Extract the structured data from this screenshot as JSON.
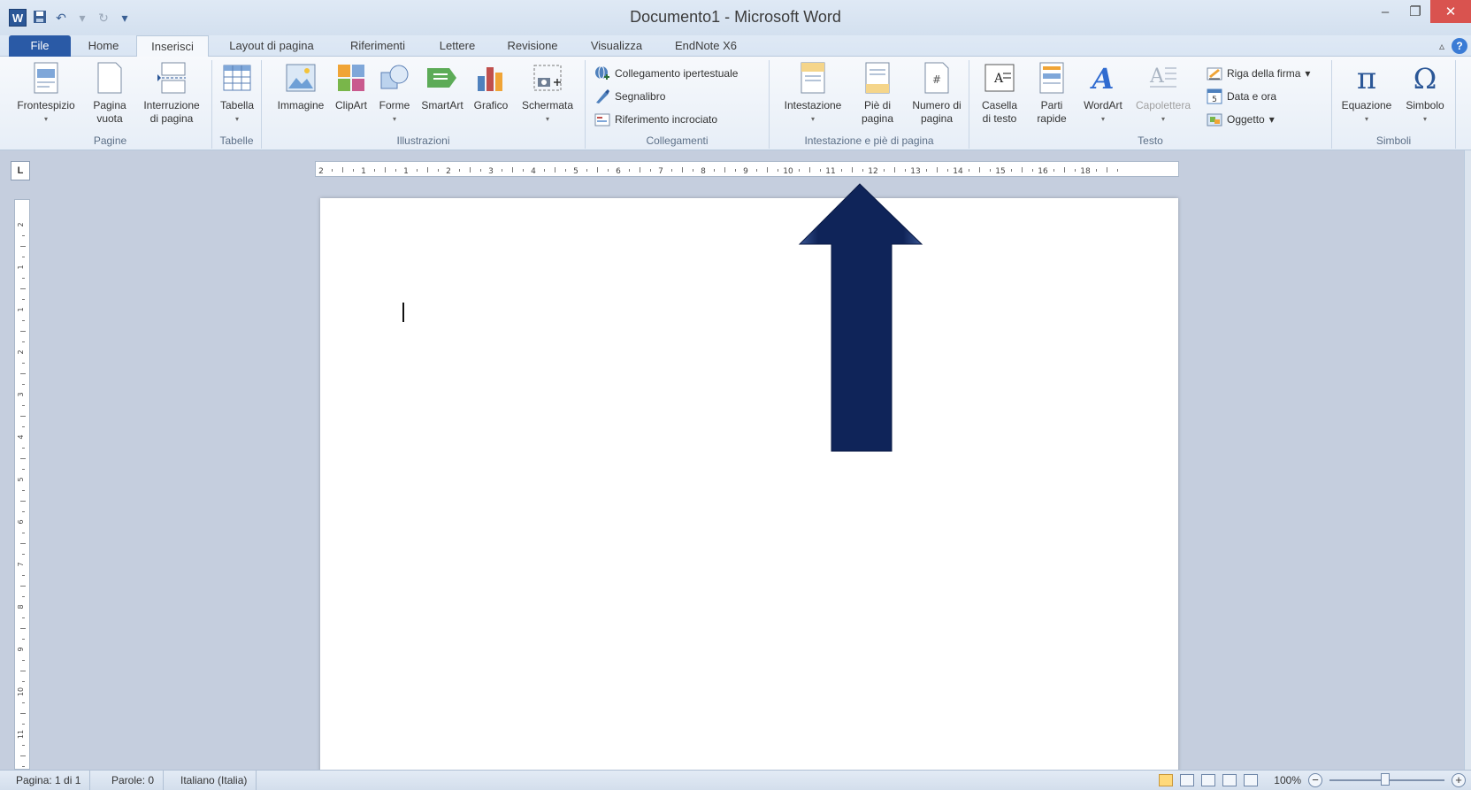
{
  "app": {
    "title": "Documento1 - Microsoft Word",
    "logo": "W"
  },
  "quick_access": {
    "icons": [
      "save-icon",
      "undo-icon",
      "redo-icon",
      "customize-icon"
    ]
  },
  "tabs": [
    {
      "label": "File"
    },
    {
      "label": "Home"
    },
    {
      "label": "Inserisci"
    },
    {
      "label": "Layout di pagina"
    },
    {
      "label": "Riferimenti"
    },
    {
      "label": "Lettere"
    },
    {
      "label": "Revisione"
    },
    {
      "label": "Visualizza"
    },
    {
      "label": "EndNote X6"
    }
  ],
  "active_tab": "Inserisci",
  "ribbon": {
    "pagine": {
      "label": "Pagine",
      "frontespizio": "Frontespizio",
      "pagina_vuota_1": "Pagina",
      "pagina_vuota_2": "vuota",
      "interruzione_1": "Interruzione",
      "interruzione_2": "di pagina"
    },
    "tabelle": {
      "label": "Tabelle",
      "tabella": "Tabella"
    },
    "illustrazioni": {
      "label": "Illustrazioni",
      "immagine": "Immagine",
      "clipart": "ClipArt",
      "forme": "Forme",
      "smartart": "SmartArt",
      "grafico": "Grafico",
      "schermata": "Schermata"
    },
    "collegamenti": {
      "label": "Collegamenti",
      "ipertestuale": "Collegamento ipertestuale",
      "segnalibro": "Segnalibro",
      "riferimento": "Riferimento incrociato"
    },
    "intestazione": {
      "label": "Intestazione e piè di pagina",
      "intestazione": "Intestazione",
      "pie_1": "Piè di",
      "pie_2": "pagina",
      "numero_1": "Numero di",
      "numero_2": "pagina"
    },
    "testo": {
      "label": "Testo",
      "casella_1": "Casella",
      "casella_2": "di testo",
      "parti_1": "Parti",
      "parti_2": "rapide",
      "wordart": "WordArt",
      "capolettera": "Capolettera",
      "riga_firma": "Riga della firma",
      "data_ora": "Data e ora",
      "oggetto": "Oggetto"
    },
    "simboli": {
      "label": "Simboli",
      "equazione": "Equazione",
      "simbolo": "Simbolo"
    }
  },
  "ruler": {
    "h_numbers": [
      "2",
      "1",
      "1",
      "2",
      "3",
      "4",
      "5",
      "6",
      "7",
      "8",
      "9",
      "10",
      "11",
      "12",
      "13",
      "14",
      "15",
      "16",
      "18"
    ],
    "v_numbers": [
      "2",
      "1",
      "1",
      "2",
      "3",
      "4",
      "5",
      "6",
      "7",
      "8",
      "9",
      "10",
      "11"
    ]
  },
  "status": {
    "page": "Pagina: 1 di 1",
    "words": "Parole: 0",
    "language": "Italiano (Italia)",
    "zoom": "100%",
    "zoom_level": 1.0
  },
  "colors": {
    "arrow": "#0f2459",
    "file_tab": "#2a5aa6",
    "close": "#d9534f"
  }
}
